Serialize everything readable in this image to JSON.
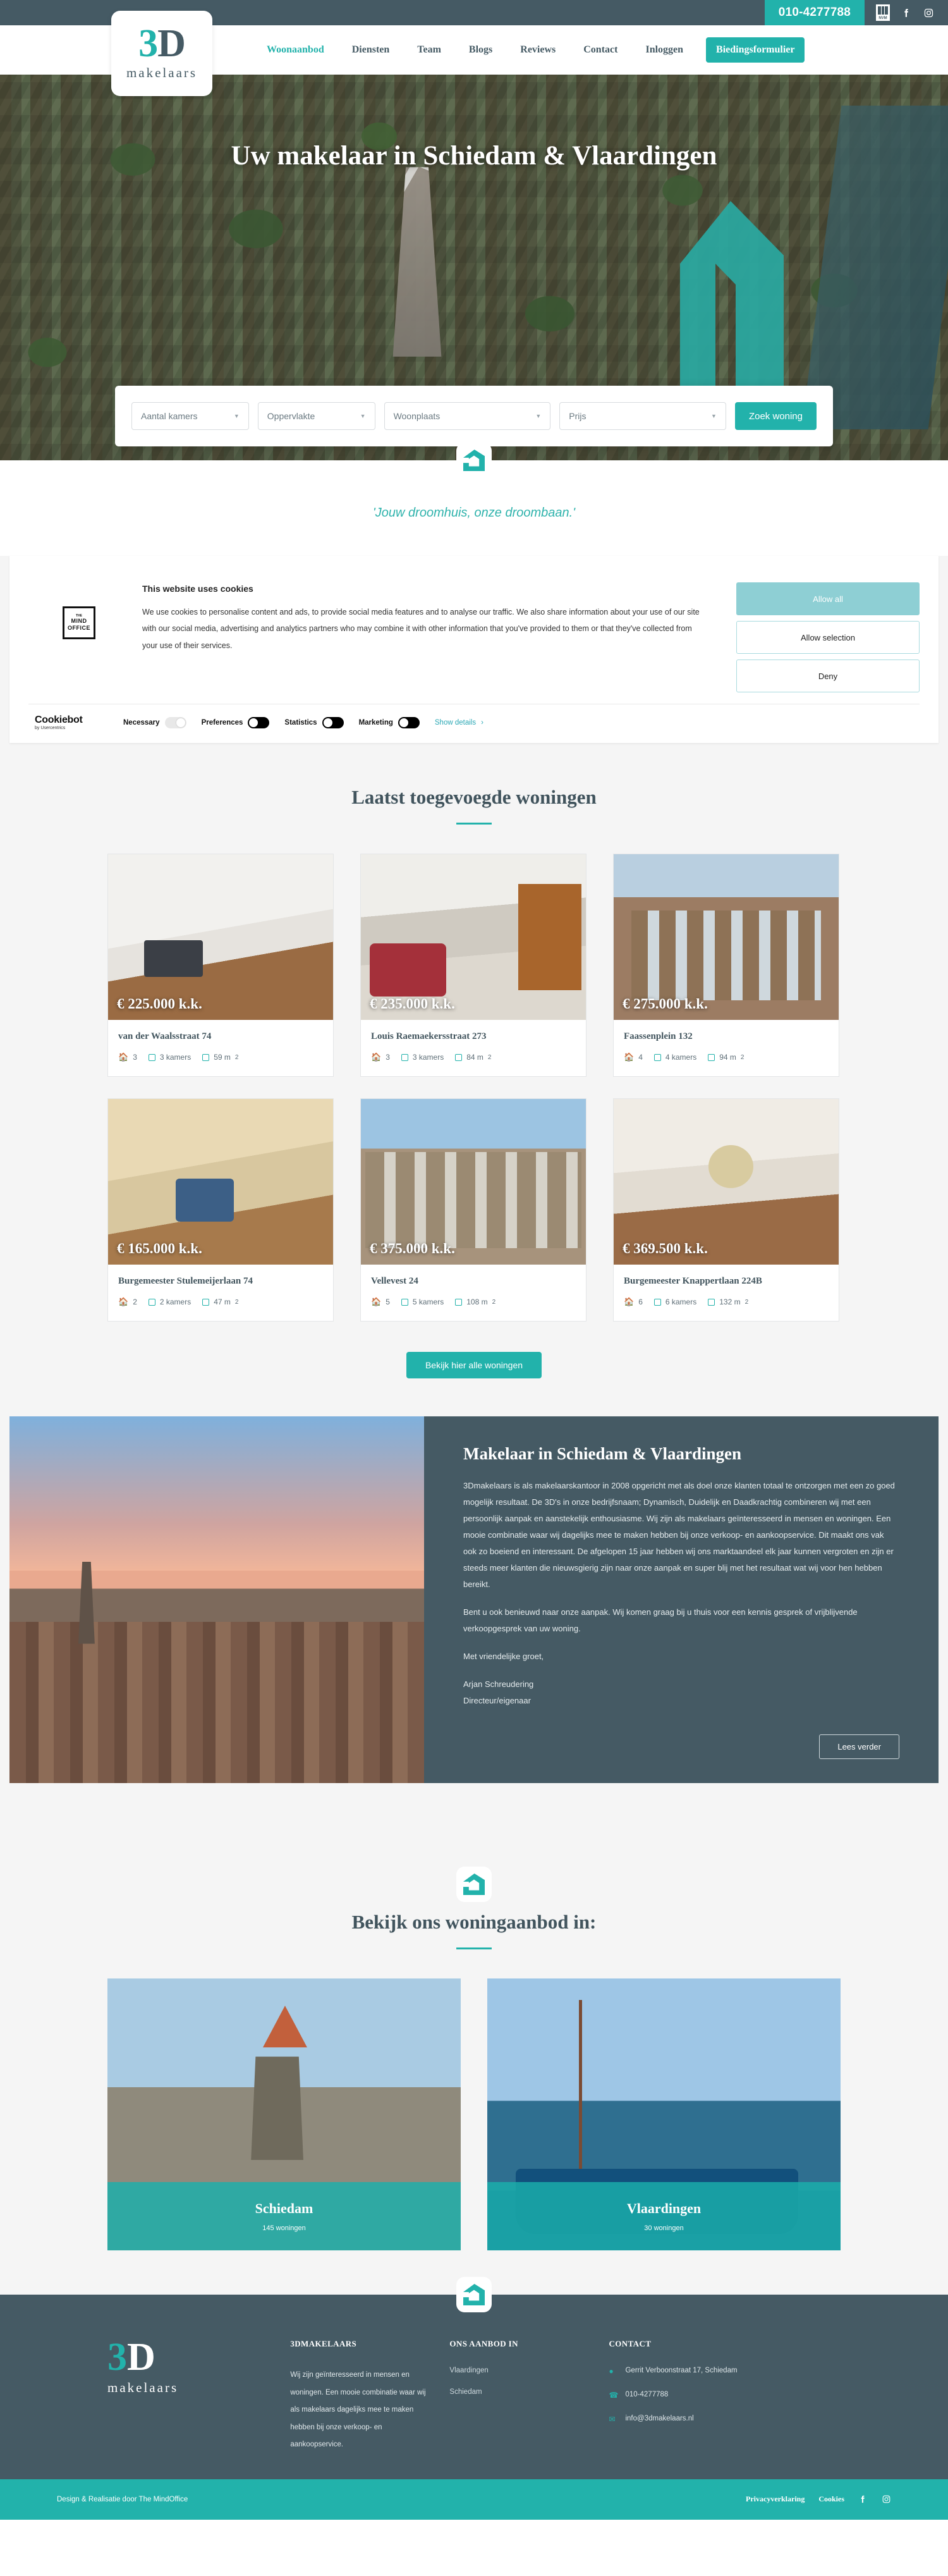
{
  "topbar": {
    "phone": "010-4277788",
    "nvm_label": "NVM",
    "facebook_icon": "facebook-icon",
    "instagram_icon": "instagram-icon"
  },
  "brand": {
    "logo_three": "3",
    "logo_d": "D",
    "logo_word": "makelaars"
  },
  "nav": {
    "items": [
      {
        "label": "Woonaanbod",
        "active": true
      },
      {
        "label": "Diensten",
        "active": false
      },
      {
        "label": "Team",
        "active": false
      },
      {
        "label": "Blogs",
        "active": false
      },
      {
        "label": "Reviews",
        "active": false
      },
      {
        "label": "Contact",
        "active": false
      },
      {
        "label": "Inloggen",
        "active": false
      }
    ],
    "cta": "Biedingsformulier"
  },
  "hero": {
    "title": "Uw makelaar in Schiedam & Vlaardingen",
    "search": {
      "rooms": "Aantal kamers",
      "surface": "Oppervlakte",
      "city": "Woonplaats",
      "price": "Prijs",
      "button": "Zoek woning"
    }
  },
  "tagline": "'Jouw droomhuis, onze droombaan.'",
  "cookie": {
    "brand_line1": "THE",
    "brand_line2": "MIND",
    "brand_line3": "OFFICE",
    "title": "This website uses cookies",
    "text": "We use cookies to personalise content and ads, to provide social media features and to analyse our traffic. We also share information about your use of our site with our social media, advertising and analytics partners who may combine it with other information that you've provided to them or that they've collected from your use of their services.",
    "allow_all": "Allow all",
    "allow_selection": "Allow selection",
    "deny": "Deny",
    "cookiebot": "Cookiebot",
    "cookiebot_sub": "by Usercentrics",
    "toggles": [
      {
        "label": "Necessary",
        "state": "locked-on"
      },
      {
        "label": "Preferences",
        "state": "off"
      },
      {
        "label": "Statistics",
        "state": "off"
      },
      {
        "label": "Marketing",
        "state": "off"
      }
    ],
    "show_details": "Show details",
    "chevron": "chevron-right-icon"
  },
  "listings": {
    "title": "Laatst toegevoegde woningen",
    "cta": "Bekijk hier alle woningen",
    "items": [
      {
        "price": "€ 225.000 k.k.",
        "address": "van der Waalsstraat 74",
        "beds": "3",
        "rooms": "3 kamers",
        "area": "59 m",
        "area_sup": "2"
      },
      {
        "price": "€ 235.000 k.k.",
        "address": "Louis Raemaekersstraat 273",
        "beds": "3",
        "rooms": "3 kamers",
        "area": "84 m",
        "area_sup": "2"
      },
      {
        "price": "€ 275.000 k.k.",
        "address": "Faassenplein 132",
        "beds": "4",
        "rooms": "4 kamers",
        "area": "94 m",
        "area_sup": "2"
      },
      {
        "price": "€ 165.000 k.k.",
        "address": "Burgemeester Stulemeijerlaan 74",
        "beds": "2",
        "rooms": "2 kamers",
        "area": "47 m",
        "area_sup": "2"
      },
      {
        "price": "€ 375.000 k.k.",
        "address": "Vellevest 24",
        "beds": "5",
        "rooms": "5 kamers",
        "area": "108 m",
        "area_sup": "2"
      },
      {
        "price": "€ 369.500 k.k.",
        "address": "Burgemeester Knappertlaan 224B",
        "beds": "6",
        "rooms": "6 kamers",
        "area": "132 m",
        "area_sup": "2"
      }
    ]
  },
  "about": {
    "title": "Makelaar in Schiedam & Vlaardingen",
    "p1": "3Dmakelaars is als makelaarskantoor in 2008 opgericht met als doel onze klanten totaal te ontzorgen met een zo goed mogelijk resultaat. De 3D's in onze bedrijfsnaam; Dynamisch, Duidelijk en Daadkrachtig combineren wij met een persoonlijk aanpak en aanstekelijk enthousiasme. Wij zijn als makelaars geïnteresseerd in mensen en woningen. Een mooie combinatie waar wij dagelijks mee te maken hebben bij onze verkoop- en aankoopservice. Dit maakt ons vak ook zo boeiend en interessant. De afgelopen 15 jaar hebben wij ons marktaandeel elk jaar kunnen vergroten en zijn er steeds meer klanten die nieuwsgierig zijn naar onze aanpak en super blij met het resultaat wat wij voor hen hebben bereikt.",
    "p2": "Bent u ook benieuwd naar onze aanpak. Wij komen graag bij u thuis voor een kennis gesprek of vrijblijvende verkoopgesprek van uw woning.",
    "p3": "Met vriendelijke groet,",
    "signature_name": "Arjan Schreudering",
    "signature_role": "Directeur/eigenaar",
    "button": "Lees verder"
  },
  "cities": {
    "title": "Bekijk ons woningaanbod in:",
    "items": [
      {
        "name": "Schiedam",
        "count": "145 woningen"
      },
      {
        "name": "Vlaardingen",
        "count": "30 woningen"
      }
    ]
  },
  "footer": {
    "col1_title": "3DMAKELAARS",
    "col1_text": "Wij zijn geïnteresseerd in mensen en woningen. Een mooie combinatie waar wij als makelaars dagelijks mee te maken hebben bij onze verkoop- en aankoopservice.",
    "col2_title": "ONS AANBOD IN",
    "col2_items": [
      "Vlaardingen",
      "Schiedam"
    ],
    "col3_title": "CONTACT",
    "address": "Gerrit Verboonstraat 17, Schiedam",
    "phone": "010-4277788",
    "email": "info@3dmakelaars.nl",
    "bottom_left": "Design & Realisatie door The MindOffice",
    "bottom_links": [
      "Privacyverklaring",
      "Cookies"
    ]
  }
}
